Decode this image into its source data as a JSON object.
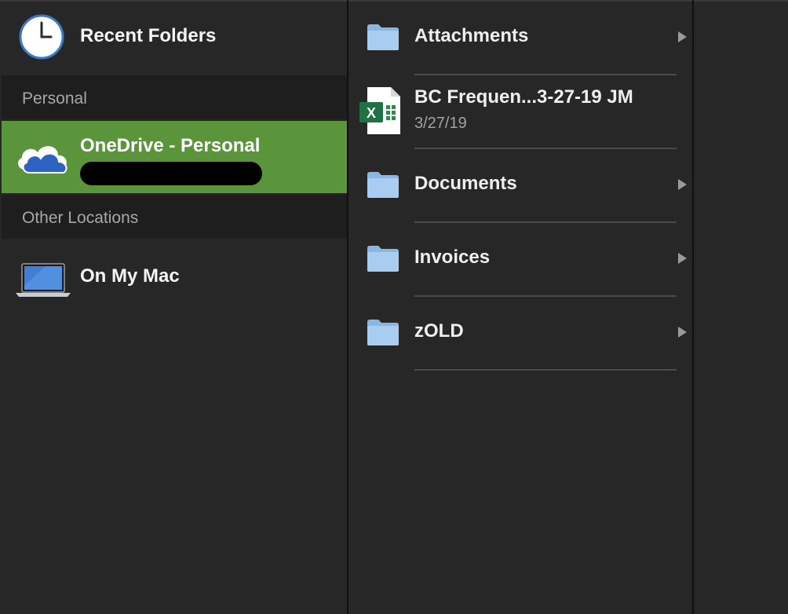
{
  "sidebar": {
    "recent": {
      "label": "Recent Folders",
      "icon": "clock-icon"
    },
    "sections": [
      {
        "label": "Personal"
      },
      {
        "label": "Other Locations"
      }
    ],
    "onedrive": {
      "label": "OneDrive - Personal",
      "icon": "onedrive-cloud-icon",
      "selected_color": "#5b953b"
    },
    "on_my_mac": {
      "label": "On My Mac",
      "icon": "laptop-icon"
    }
  },
  "files": [
    {
      "label": "Attachments",
      "type": "folder",
      "icon": "folder-icon"
    },
    {
      "label": "BC Frequen...3-27-19 JM",
      "date": "3/27/19",
      "type": "excel",
      "icon": "excel-file-icon"
    },
    {
      "label": "Documents",
      "type": "folder",
      "icon": "folder-icon"
    },
    {
      "label": "Invoices",
      "type": "folder",
      "icon": "folder-icon"
    },
    {
      "label": "zOLD",
      "type": "folder",
      "icon": "folder-icon"
    }
  ]
}
